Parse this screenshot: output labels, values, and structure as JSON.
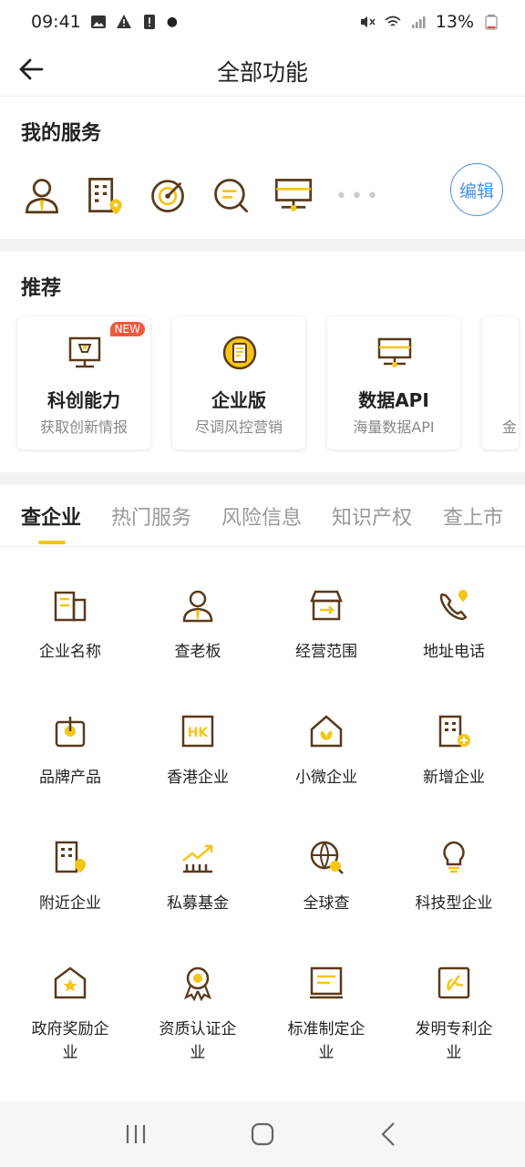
{
  "status": {
    "time": "09:41",
    "battery": "13%"
  },
  "header": {
    "title": "全部功能"
  },
  "my_service": {
    "title": "我的服务",
    "more": "•••",
    "edit_label": "编辑",
    "icons": [
      "person-icon",
      "building-location-icon",
      "target-icon",
      "search-chat-icon",
      "monitor-network-icon"
    ]
  },
  "recommend": {
    "title": "推荐",
    "cards": [
      {
        "name": "科创能力",
        "desc": "获取创新情报",
        "badge": "NEW",
        "icon": "monitor-icon"
      },
      {
        "name": "企业版",
        "desc": "尽调风控营销",
        "icon": "coin-doc-icon"
      },
      {
        "name": "数据API",
        "desc": "海量数据API",
        "icon": "monitor-network-icon"
      },
      {
        "name": "",
        "desc": "金",
        "icon": ""
      }
    ]
  },
  "tabs": [
    "查企业",
    "热门服务",
    "风险信息",
    "知识产权",
    "查上市"
  ],
  "active_tab": "查企业",
  "grid": [
    {
      "label": "企业名称",
      "icon": "building-icon"
    },
    {
      "label": "查老板",
      "icon": "person-icon"
    },
    {
      "label": "经营范围",
      "icon": "shop-icon"
    },
    {
      "label": "地址电话",
      "icon": "phone-location-icon"
    },
    {
      "label": "品牌产品",
      "icon": "brand-icon"
    },
    {
      "label": "香港企业",
      "icon": "hk-icon"
    },
    {
      "label": "小微企业",
      "icon": "house-leaf-icon"
    },
    {
      "label": "新增企业",
      "icon": "building-plus-icon"
    },
    {
      "label": "附近企业",
      "icon": "building-location-icon"
    },
    {
      "label": "私募基金",
      "icon": "chart-up-icon"
    },
    {
      "label": "全球查",
      "icon": "globe-search-icon"
    },
    {
      "label": "科技型企业",
      "icon": "lightbulb-icon"
    },
    {
      "label": "政府奖励企\n业",
      "icon": "star-house-icon"
    },
    {
      "label": "资质认证企\n业",
      "icon": "award-icon"
    },
    {
      "label": "标准制定企\n业",
      "icon": "document-icon"
    },
    {
      "label": "发明专利企\n业",
      "icon": "patent-icon"
    }
  ],
  "colors": {
    "accent": "#f5c518",
    "brown": "#5a3a1a",
    "blue": "#4a90e2",
    "badge": "#f15a3d"
  }
}
